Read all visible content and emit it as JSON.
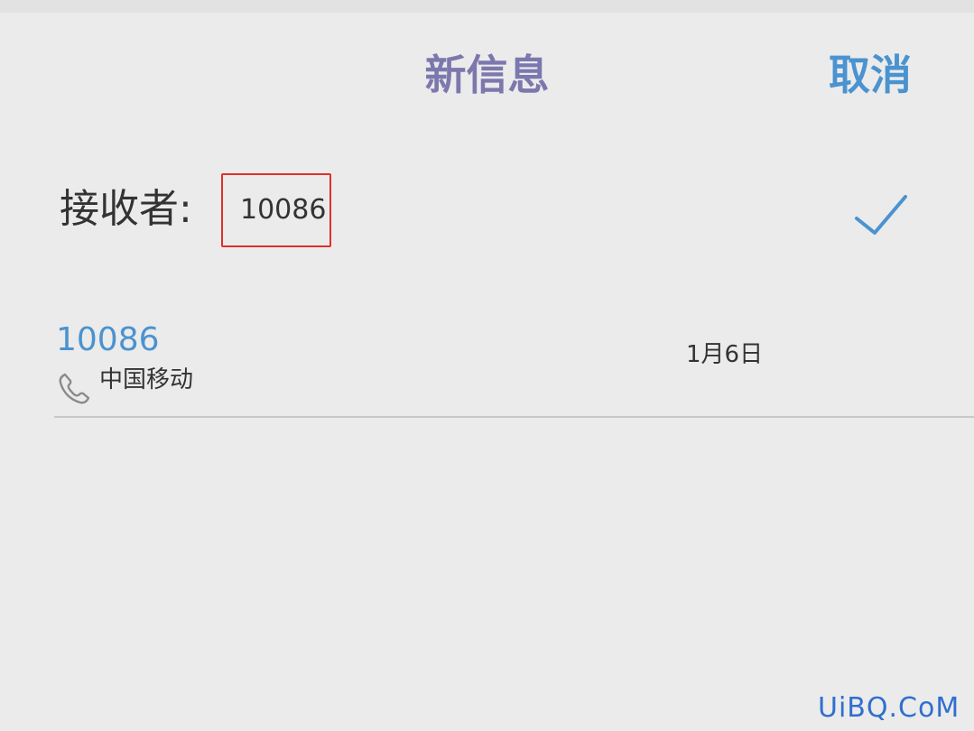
{
  "header": {
    "title": "新信息",
    "cancel_label": "取消"
  },
  "recipient": {
    "label": "接收者:",
    "value": "10086",
    "confirm_icon": "checkmark-icon"
  },
  "suggestions": [
    {
      "number": "10086",
      "name": "中国移动",
      "date": "1月6日",
      "icon": "phone-icon"
    }
  ],
  "watermark": "UiBQ.CoM",
  "colors": {
    "title": "#7c78ae",
    "accent": "#4a93d0",
    "highlight_box": "#e0302a",
    "background": "#ebebeb"
  }
}
